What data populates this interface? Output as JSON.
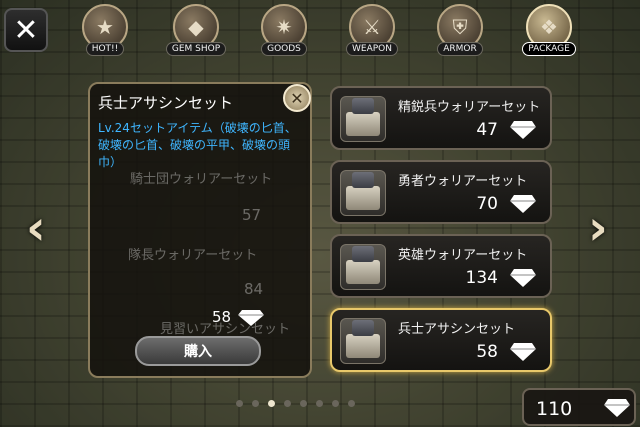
{
  "top": {
    "close_glyph": "✕",
    "tabs": [
      {
        "label": "HOT!!",
        "icon": "star-icon",
        "glyph": "★"
      },
      {
        "label": "GEM SHOP",
        "icon": "gem-icon",
        "glyph": "◆"
      },
      {
        "label": "GOODS",
        "icon": "compass-icon",
        "glyph": "✷"
      },
      {
        "label": "WEAPON",
        "icon": "sword-icon",
        "glyph": "⚔"
      },
      {
        "label": "ARMOR",
        "icon": "shield-icon",
        "glyph": "⛨"
      },
      {
        "label": "PACKAGE",
        "icon": "bag-icon",
        "glyph": "❖"
      }
    ]
  },
  "nav": {
    "prev": "‹",
    "next": "›"
  },
  "left_list_ghosts": [
    {
      "name": "騎士団ウォリアーセット",
      "price": "57"
    },
    {
      "name": "隊長ウォリアーセット",
      "price": "84"
    },
    {
      "name": "見習いアサシンセット",
      "price": "58"
    }
  ],
  "detail": {
    "title": "兵士アサシンセット",
    "close_glyph": "✕",
    "desc": "Lv.24セットアイテム（破壊の匕首、破壊の匕首、破壊の平甲、破壊の頭巾）",
    "price": "58",
    "buy_label": "購入"
  },
  "items": [
    {
      "name": "精鋭兵ウォリアーセット",
      "price": "47"
    },
    {
      "name": "勇者ウォリアーセット",
      "price": "70"
    },
    {
      "name": "英雄ウォリアーセット",
      "price": "134"
    },
    {
      "name": "兵士アサシンセット",
      "price": "58"
    }
  ],
  "balance": "110",
  "colors": {
    "desc": "#3fb6ff",
    "selected_border": "#e8c86a"
  }
}
